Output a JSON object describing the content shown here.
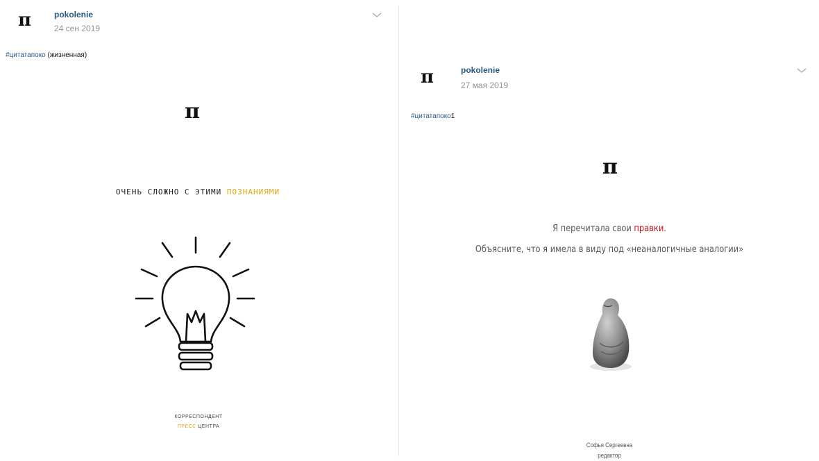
{
  "post1": {
    "avatar_glyph": "π",
    "author": "pokolenie",
    "date": "24 сен 2019",
    "caption_hashtag": "#цитатапоко",
    "caption_text": " (жизненная)",
    "image": {
      "logo": "π",
      "headline_part1": "ОЧЕНЬ СЛОЖНО С ЭТИМИ ",
      "headline_accent": "ПОЗНАНИЯМИ",
      "footer_line1": "КОРРЕСПОНДЕНТ",
      "footer_accent": "ПРЕСС",
      "footer_line2_rest": " ЦЕНТРА",
      "accent_color": "#e0a516"
    }
  },
  "post2": {
    "avatar_glyph": "π",
    "author": "pokolenie",
    "date": "27 мая 2019",
    "caption_hashtag": "#цитатапоко",
    "caption_text": "1",
    "image": {
      "logo": "π",
      "quote_part1": "Я перечитала свои ",
      "quote_accent": "правки",
      "quote_part1_end": ".",
      "quote_line2": "Объясните, что я имела в виду под «неаналогичные аналогии»",
      "signature_name": "Софья Сергеевна",
      "signature_role": "редактор",
      "accent_color": "#c0141a"
    }
  }
}
